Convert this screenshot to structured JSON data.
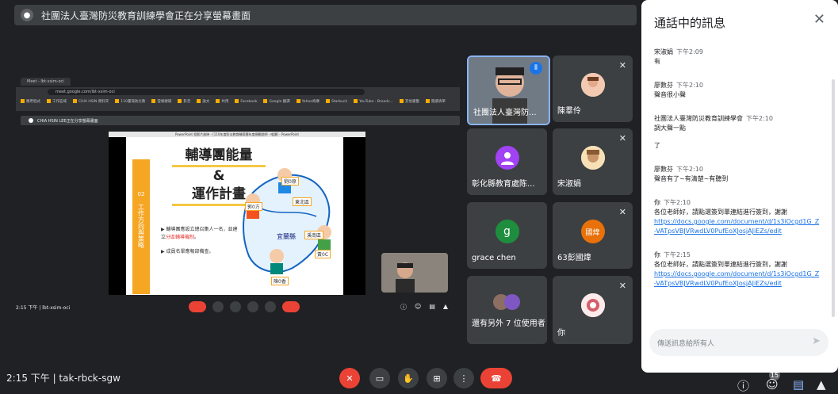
{
  "banner": {
    "text": "社團法人臺灣防災教育訓練學會正在分享螢幕畫面"
  },
  "mini_browser": {
    "tabs": [
      "Meet - lbt-xsim-oci",
      ""
    ],
    "address": "meet.google.com/lbt-xsim-oci",
    "bookmarks": [
      "應用程式",
      "工作區域",
      "CHIA HSIN 資料夾",
      "110臺灣防災教",
      "雲端硬碟",
      "影音",
      "論文",
      "共用",
      "Facebook",
      "Google 翻譯",
      "Yahoo奇摩",
      "Starbuck",
      "YouTube - Broadc...",
      "其他書籤",
      "閱讀清單"
    ],
    "present_text": "CHIA HSIN LEE正在分享螢幕畫面",
    "slide_window_title": "PowerPoint 投影片放映 - [110年度防災教育輔導團年度規劃說明 - 唯讀] - PowerPoint",
    "slide": {
      "side_num": "02",
      "side_text": "工作方向與策略",
      "title_1": "輔導團能量",
      "title_2": "&",
      "title_3": "運作計畫",
      "bullet_1a": "輔導團應設立總召集人一名，並建立",
      "bullet_1b": "分區輔導機制",
      "bullet_2a": "成員名單應報部備查",
      "county": "宜蘭縣",
      "labels": [
        "劉0原",
        "郭0方",
        "東北區",
        "溪南區",
        "黃0C",
        "陳0香"
      ]
    },
    "time_text": "2:15 下午 | lbt-xsim-oci",
    "icons_right": [
      "info-icon",
      "people-icon",
      "chat-icon",
      "activities-icon"
    ]
  },
  "participants": [
    {
      "name": "社團法人臺灣防...",
      "speaking": true
    },
    {
      "name": "陳羣伶",
      "muted": true
    },
    {
      "name": "彰化縣教育處陈...",
      "avatar": "person-icon",
      "avatar_color": "#a142f4"
    },
    {
      "name": "宋淑娟",
      "muted": true
    },
    {
      "name": "grace chen",
      "avatar": "g",
      "avatar_color": "#1e8e3e"
    },
    {
      "name": "63彭國煒",
      "avatar": "國煒",
      "avatar_color": "#e8710a",
      "muted": true
    },
    {
      "name": "還有另外 7 位使用者"
    },
    {
      "name": "你",
      "muted": true
    }
  ],
  "bottom": {
    "meeting_info": "2:15 下午  |  tak-rbck-sgw",
    "people_count": "15"
  },
  "chat": {
    "title": "通話中的訊息",
    "messages": [
      {
        "sender": "宋淑娟",
        "time": "下午2:09",
        "lines": [
          "有"
        ]
      },
      {
        "sender": "廖數芬",
        "time": "下午2:10",
        "lines": [
          "聲音很小聲"
        ]
      },
      {
        "sender": "社團法人臺灣防災教育訓練學會",
        "time": "下午2:10",
        "lines": [
          "調大聲一點",
          "了"
        ]
      },
      {
        "sender": "廖數芬",
        "time": "下午2:10",
        "lines": [
          "聲音有了~有清楚~有聽到"
        ]
      },
      {
        "sender": "你",
        "time": "下午2:10",
        "lines": [
          "各位老師好，請點選簽到單連結進行簽到，謝謝"
        ],
        "link": "https://docs.google.com/document/d/1s3iOcgd1G_Z-VATpsVBJVRwdLV0PufEoXJosjAJiEZs/edit"
      },
      {
        "sender": "你",
        "time": "下午2:15",
        "lines": [
          "各位老師好，請點選簽到單連結進行簽到，謝謝"
        ],
        "link": "https://docs.google.com/document/d/1s3iOcgd1G_Z-VATpsVBJVRwdLV0PufEoXJosjAJiEZs/edit"
      }
    ],
    "input_placeholder": "傳送訊息給所有人"
  }
}
